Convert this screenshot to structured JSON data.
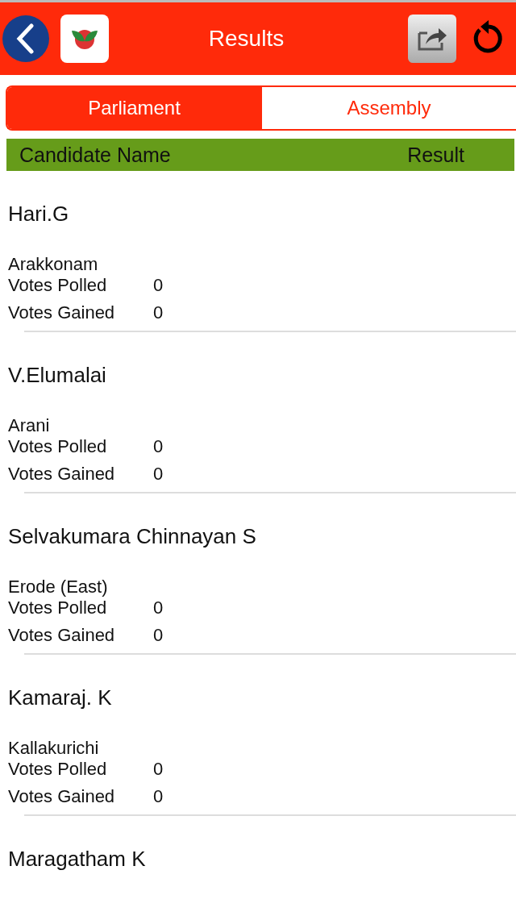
{
  "header": {
    "title": "Results"
  },
  "tabs": [
    {
      "label": "Parliament",
      "selected": true
    },
    {
      "label": "Assembly",
      "selected": false
    }
  ],
  "table": {
    "columns": [
      "Candidate Name",
      "Result"
    ]
  },
  "candidates": [
    {
      "name": "Hari.G",
      "constituency": "Arakkonam",
      "stats": [
        {
          "label": "Votes Polled",
          "value": "0"
        },
        {
          "label": "Votes Gained",
          "value": "0"
        }
      ]
    },
    {
      "name": "V.Elumalai",
      "constituency": "Arani",
      "stats": [
        {
          "label": "Votes Polled",
          "value": "0"
        },
        {
          "label": "Votes Gained",
          "value": "0"
        }
      ]
    },
    {
      "name": "Selvakumara Chinnayan S",
      "constituency": "Erode (East)",
      "stats": [
        {
          "label": "Votes Polled",
          "value": "0"
        },
        {
          "label": "Votes Gained",
          "value": "0"
        }
      ]
    },
    {
      "name": "Kamaraj. K",
      "constituency": "Kallakurichi",
      "stats": [
        {
          "label": "Votes Polled",
          "value": "0"
        },
        {
          "label": "Votes Gained",
          "value": "0"
        }
      ]
    },
    {
      "name": "Maragatham K"
    }
  ]
}
